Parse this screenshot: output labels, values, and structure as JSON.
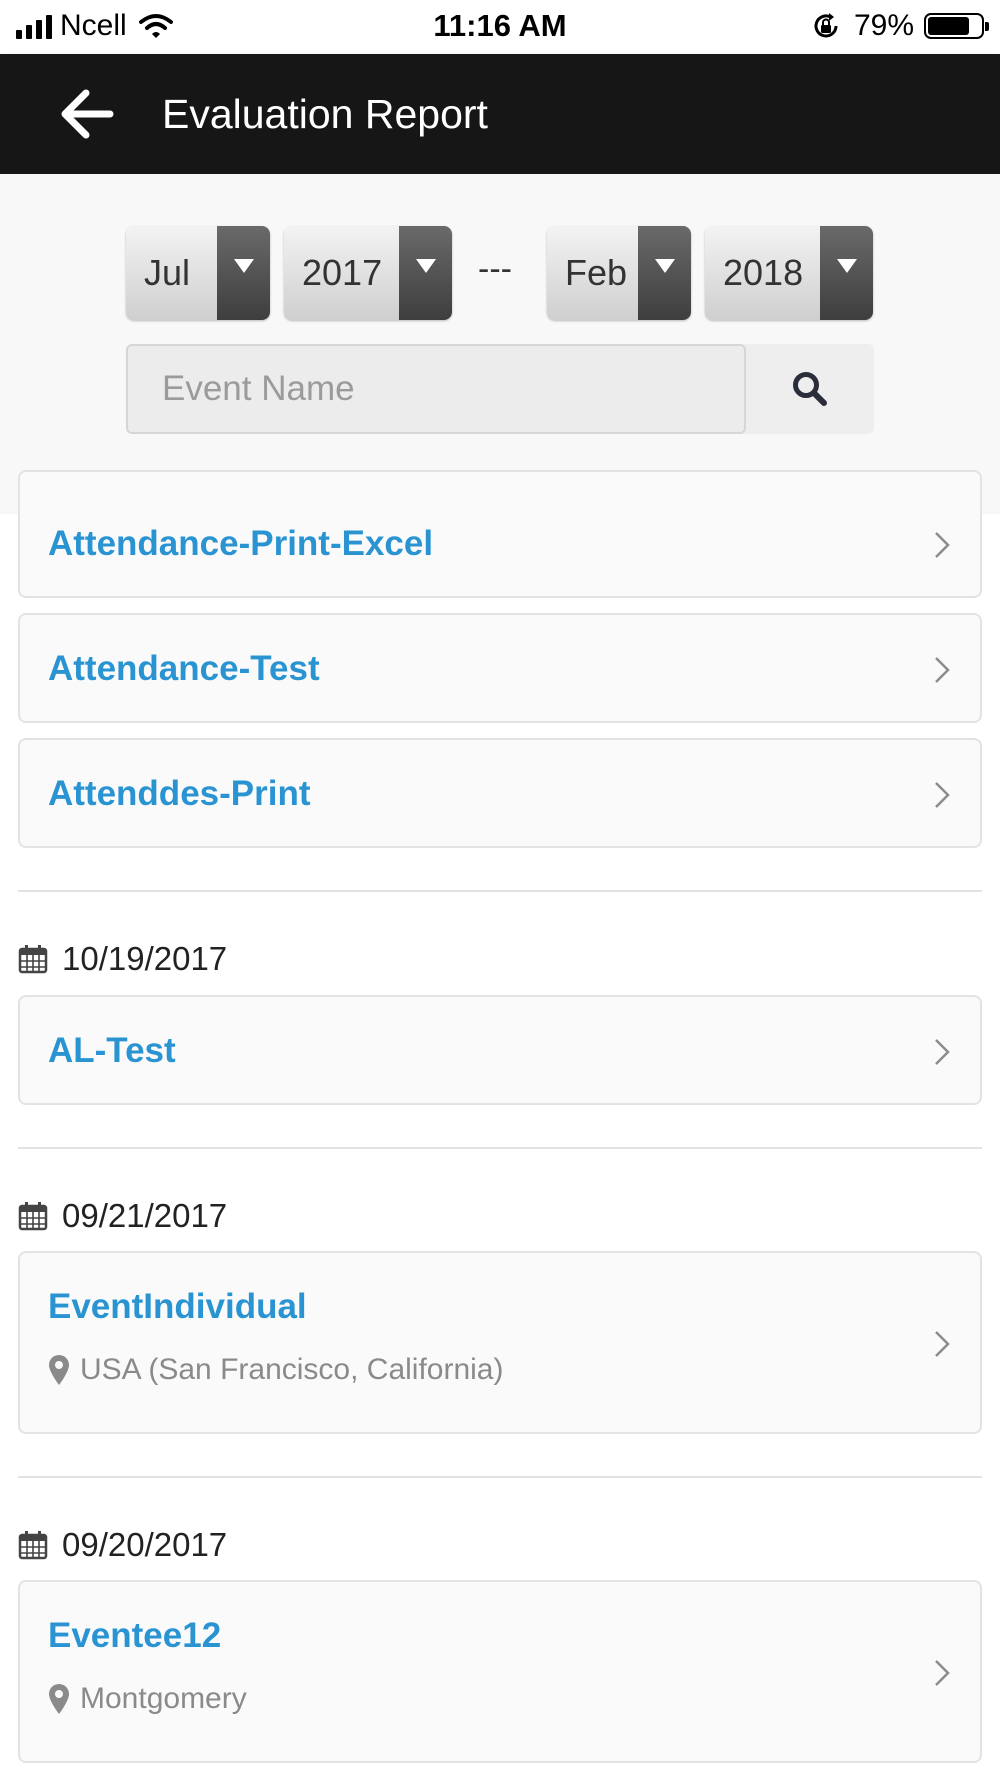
{
  "status_bar": {
    "carrier": "Ncell",
    "time": "11:16 AM",
    "battery": "79%",
    "battery_level": 0.79
  },
  "header": {
    "title": "Evaluation Report",
    "back_icon": "arrow-left-icon"
  },
  "filter": {
    "from_month": "Jul",
    "from_year": "2017",
    "separator": "---",
    "to_month": "Feb",
    "to_year": "2018",
    "search_placeholder": "Event Name",
    "search_icon": "search-icon"
  },
  "events_top": [
    {
      "title": "Attendance-Print-Excel"
    },
    {
      "title": "Attendance-Test"
    },
    {
      "title": "Attenddes-Print"
    }
  ],
  "groups": [
    {
      "date": "10/19/2017",
      "events": [
        {
          "title": "AL-Test"
        }
      ]
    },
    {
      "date": "09/21/2017",
      "events": [
        {
          "title": "EventIndividual",
          "location": "USA (San Francisco, California)"
        }
      ]
    },
    {
      "date": "09/20/2017",
      "events": [
        {
          "title": "Eventee12",
          "location": "Montgomery"
        }
      ]
    }
  ],
  "colors": {
    "header_bg": "#161616",
    "event_title": "#2a94d2",
    "location_text": "#8a8a8a"
  }
}
